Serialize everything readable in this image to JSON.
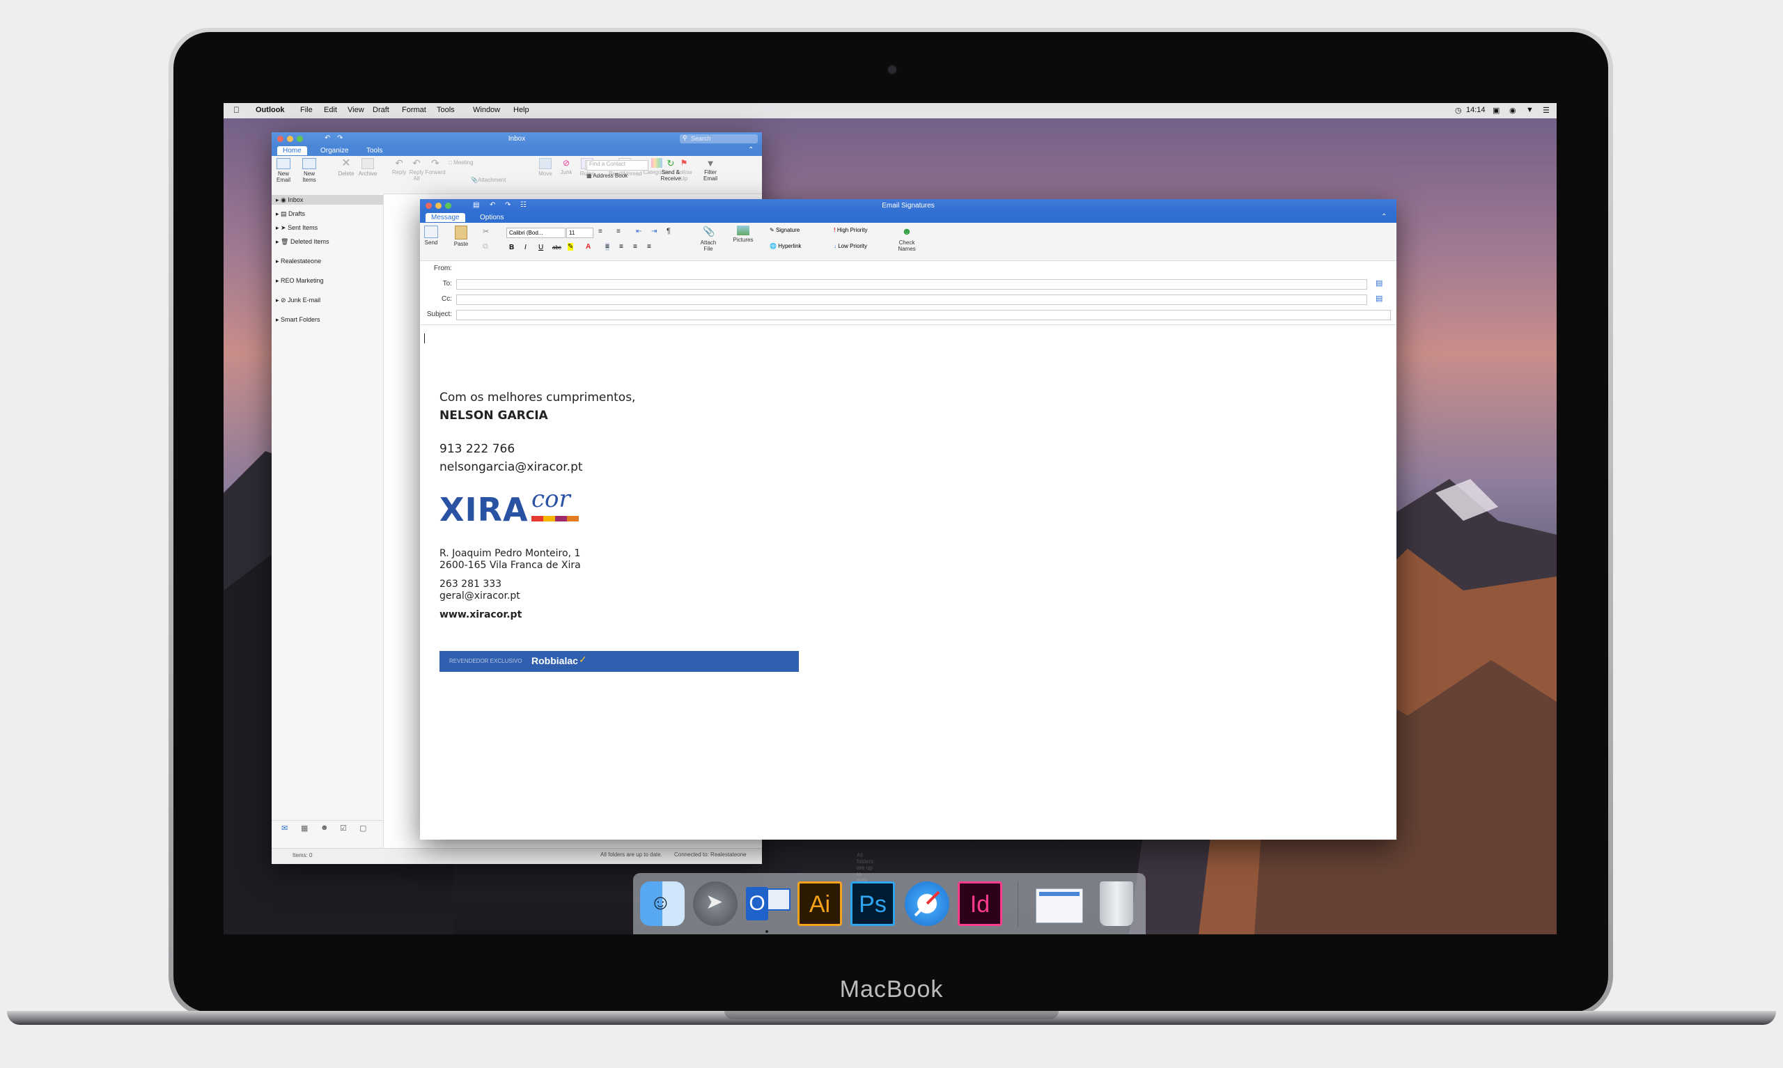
{
  "device": {
    "brand": "MacBook"
  },
  "menubar": {
    "app": "Outlook",
    "items": [
      "File",
      "Edit",
      "View",
      "Draft",
      "Format",
      "Tools",
      "Window",
      "Help"
    ],
    "time": "14:14"
  },
  "inbox_window": {
    "title": "Inbox",
    "search_placeholder": "Search",
    "tabs": [
      "Home",
      "Organize",
      "Tools"
    ],
    "ribbon": {
      "new_email": "New Email",
      "new_items": "New Items",
      "delete": "Delete",
      "archive": "Archive",
      "reply": "Reply",
      "reply_all": "Reply All",
      "forward": "Forward",
      "meeting": "Meeting",
      "attachment": "Attachment",
      "move": "Move",
      "junk": "Junk",
      "rules": "Rules",
      "read_unread": "Read/Unread",
      "categorize": "Categorize",
      "follow_up": "Follow Up",
      "filter_email": "Filter Email",
      "find_contact_placeholder": "Find a Contact",
      "address_book": "Address Book",
      "send_receive": "Send & Receive"
    },
    "folders": [
      "Inbox",
      "Drafts",
      "Sent Items",
      "Deleted Items",
      "Realestateone",
      "REO Marketing",
      "Junk E-mail",
      "Smart Folders"
    ],
    "status": {
      "items": "Items: 0",
      "up_to_date": "All folders are up to date.",
      "connected": "Connected to: Realestateone"
    }
  },
  "compose_window": {
    "title": "Email Signatures",
    "tabs": [
      "Message",
      "Options"
    ],
    "ribbon": {
      "send": "Send",
      "paste": "Paste",
      "font": "Calibri (Bod...",
      "size": "11",
      "attach_file": "Attach File",
      "pictures": "Pictures",
      "signature": "Signature",
      "hyperlink": "Hyperlink",
      "high_priority": "High Priority",
      "low_priority": "Low Priority",
      "check_names": "Check Names"
    },
    "fields": {
      "from": "From:",
      "to": "To:",
      "cc": "Cc:",
      "subject": "Subject:"
    }
  },
  "signature": {
    "greeting": "Com os melhores cumprimentos,",
    "name": "NELSON GARCIA",
    "phone": "913 222 766",
    "email": "nelsongarcia@xiracor.pt",
    "logo_main": "XIRA",
    "logo_script": "cor",
    "address_line1": "R. Joaquim Pedro Monteiro, 1",
    "address_line2": "2600-165  Vila Franca de Xira",
    "company_phone": "263 281 333",
    "company_email": "geral@xiracor.pt",
    "website": "www.xiracor.pt",
    "banner_small": "REVENDEDOR EXCLUSIVO",
    "banner_brand": "Robbialac"
  },
  "dock": {
    "apps": [
      "finder",
      "launchpad",
      "outlook",
      "illustrator",
      "photoshop",
      "safari",
      "indesign",
      "mail-minimized",
      "trash"
    ],
    "illustrator_label": "Ai",
    "photoshop_label": "Ps",
    "indesign_label": "Id",
    "outlook_label": "O"
  },
  "colors": {
    "outlook_blue": "#2f6fd1",
    "ribbon_blue": "#4a86d8",
    "xira_blue": "#2a52a3",
    "banner_blue": "#2f5fae"
  }
}
